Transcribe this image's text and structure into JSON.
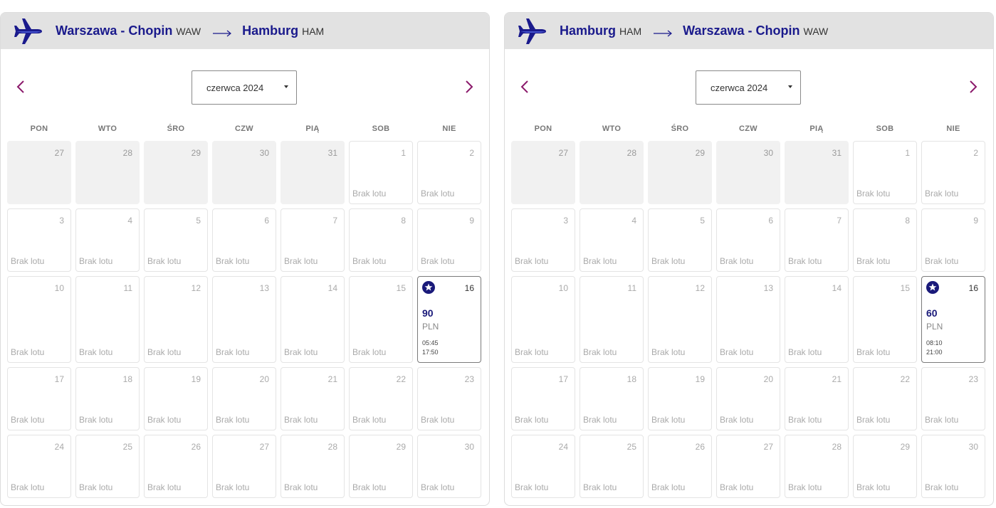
{
  "colors": {
    "brand": "#1a1a8c",
    "accent": "#8b1a6b",
    "header_bg": "#e2e2e2"
  },
  "weekdays": [
    "PON",
    "WTO",
    "ŚRO",
    "CZW",
    "PIĄ",
    "SOB",
    "NIE"
  ],
  "no_flight_label": "Brak lotu",
  "panels": [
    {
      "origin": {
        "city": "Warszawa - Chopin",
        "code": "WAW"
      },
      "destination": {
        "city": "Hamburg",
        "code": "HAM"
      },
      "month_label": "czerwca 2024",
      "days": [
        {
          "n": "27",
          "state": "outside"
        },
        {
          "n": "28",
          "state": "outside"
        },
        {
          "n": "29",
          "state": "outside"
        },
        {
          "n": "30",
          "state": "outside"
        },
        {
          "n": "31",
          "state": "outside"
        },
        {
          "n": "1",
          "state": "none"
        },
        {
          "n": "2",
          "state": "none"
        },
        {
          "n": "3",
          "state": "none"
        },
        {
          "n": "4",
          "state": "none"
        },
        {
          "n": "5",
          "state": "none"
        },
        {
          "n": "6",
          "state": "none"
        },
        {
          "n": "7",
          "state": "none"
        },
        {
          "n": "8",
          "state": "none"
        },
        {
          "n": "9",
          "state": "none"
        },
        {
          "n": "10",
          "state": "none"
        },
        {
          "n": "11",
          "state": "none"
        },
        {
          "n": "12",
          "state": "none"
        },
        {
          "n": "13",
          "state": "none"
        },
        {
          "n": "14",
          "state": "none"
        },
        {
          "n": "15",
          "state": "none"
        },
        {
          "n": "16",
          "state": "available",
          "price": "90",
          "currency": "PLN",
          "time1": "05:45",
          "time2": "17:50"
        },
        {
          "n": "17",
          "state": "none"
        },
        {
          "n": "18",
          "state": "none"
        },
        {
          "n": "19",
          "state": "none"
        },
        {
          "n": "20",
          "state": "none"
        },
        {
          "n": "21",
          "state": "none"
        },
        {
          "n": "22",
          "state": "none"
        },
        {
          "n": "23",
          "state": "none"
        },
        {
          "n": "24",
          "state": "none"
        },
        {
          "n": "25",
          "state": "none"
        },
        {
          "n": "26",
          "state": "none"
        },
        {
          "n": "27",
          "state": "none"
        },
        {
          "n": "28",
          "state": "none"
        },
        {
          "n": "29",
          "state": "none"
        },
        {
          "n": "30",
          "state": "none"
        }
      ]
    },
    {
      "origin": {
        "city": "Hamburg",
        "code": "HAM"
      },
      "destination": {
        "city": "Warszawa - Chopin",
        "code": "WAW"
      },
      "month_label": "czerwca 2024",
      "days": [
        {
          "n": "27",
          "state": "outside"
        },
        {
          "n": "28",
          "state": "outside"
        },
        {
          "n": "29",
          "state": "outside"
        },
        {
          "n": "30",
          "state": "outside"
        },
        {
          "n": "31",
          "state": "outside"
        },
        {
          "n": "1",
          "state": "none"
        },
        {
          "n": "2",
          "state": "none"
        },
        {
          "n": "3",
          "state": "none"
        },
        {
          "n": "4",
          "state": "none"
        },
        {
          "n": "5",
          "state": "none"
        },
        {
          "n": "6",
          "state": "none"
        },
        {
          "n": "7",
          "state": "none"
        },
        {
          "n": "8",
          "state": "none"
        },
        {
          "n": "9",
          "state": "none"
        },
        {
          "n": "10",
          "state": "none"
        },
        {
          "n": "11",
          "state": "none"
        },
        {
          "n": "12",
          "state": "none"
        },
        {
          "n": "13",
          "state": "none"
        },
        {
          "n": "14",
          "state": "none"
        },
        {
          "n": "15",
          "state": "none"
        },
        {
          "n": "16",
          "state": "available",
          "price": "60",
          "currency": "PLN",
          "time1": "08:10",
          "time2": "21:00"
        },
        {
          "n": "17",
          "state": "none"
        },
        {
          "n": "18",
          "state": "none"
        },
        {
          "n": "19",
          "state": "none"
        },
        {
          "n": "20",
          "state": "none"
        },
        {
          "n": "21",
          "state": "none"
        },
        {
          "n": "22",
          "state": "none"
        },
        {
          "n": "23",
          "state": "none"
        },
        {
          "n": "24",
          "state": "none"
        },
        {
          "n": "25",
          "state": "none"
        },
        {
          "n": "26",
          "state": "none"
        },
        {
          "n": "27",
          "state": "none"
        },
        {
          "n": "28",
          "state": "none"
        },
        {
          "n": "29",
          "state": "none"
        },
        {
          "n": "30",
          "state": "none"
        }
      ]
    }
  ]
}
